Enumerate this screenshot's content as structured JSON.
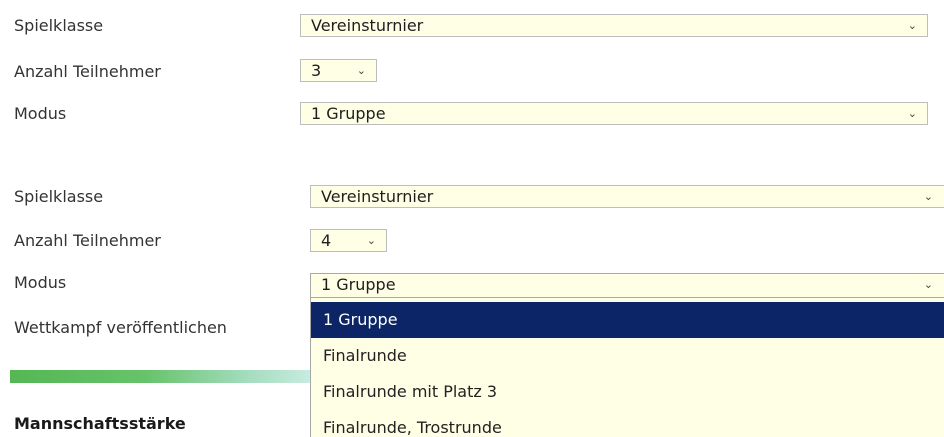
{
  "form1": {
    "spielklasse_label": "Spielklasse",
    "spielklasse_value": "Vereinsturnier",
    "teilnehmer_label": "Anzahl Teilnehmer",
    "teilnehmer_value": "3",
    "modus_label": "Modus",
    "modus_value": "1 Gruppe"
  },
  "form2": {
    "spielklasse_label": "Spielklasse",
    "spielklasse_value": "Vereinsturnier",
    "teilnehmer_label": "Anzahl Teilnehmer",
    "teilnehmer_value": "4",
    "modus_label": "Modus",
    "modus_value": "1 Gruppe",
    "publish_label": "Wettkampf veröffentlichen"
  },
  "dropdown": {
    "options": [
      "1 Gruppe",
      "Finalrunde",
      "Finalrunde mit Platz 3",
      "Finalrunde, Trostrunde"
    ],
    "selected_index": 0
  },
  "section": {
    "heading": "Mannschaftsstärke"
  },
  "icons": {
    "chevron": "chevron-down-icon"
  },
  "colors": {
    "select_background": "#ffffe6",
    "selected_option_background": "#0b2566",
    "accent_green": "#55b754"
  }
}
